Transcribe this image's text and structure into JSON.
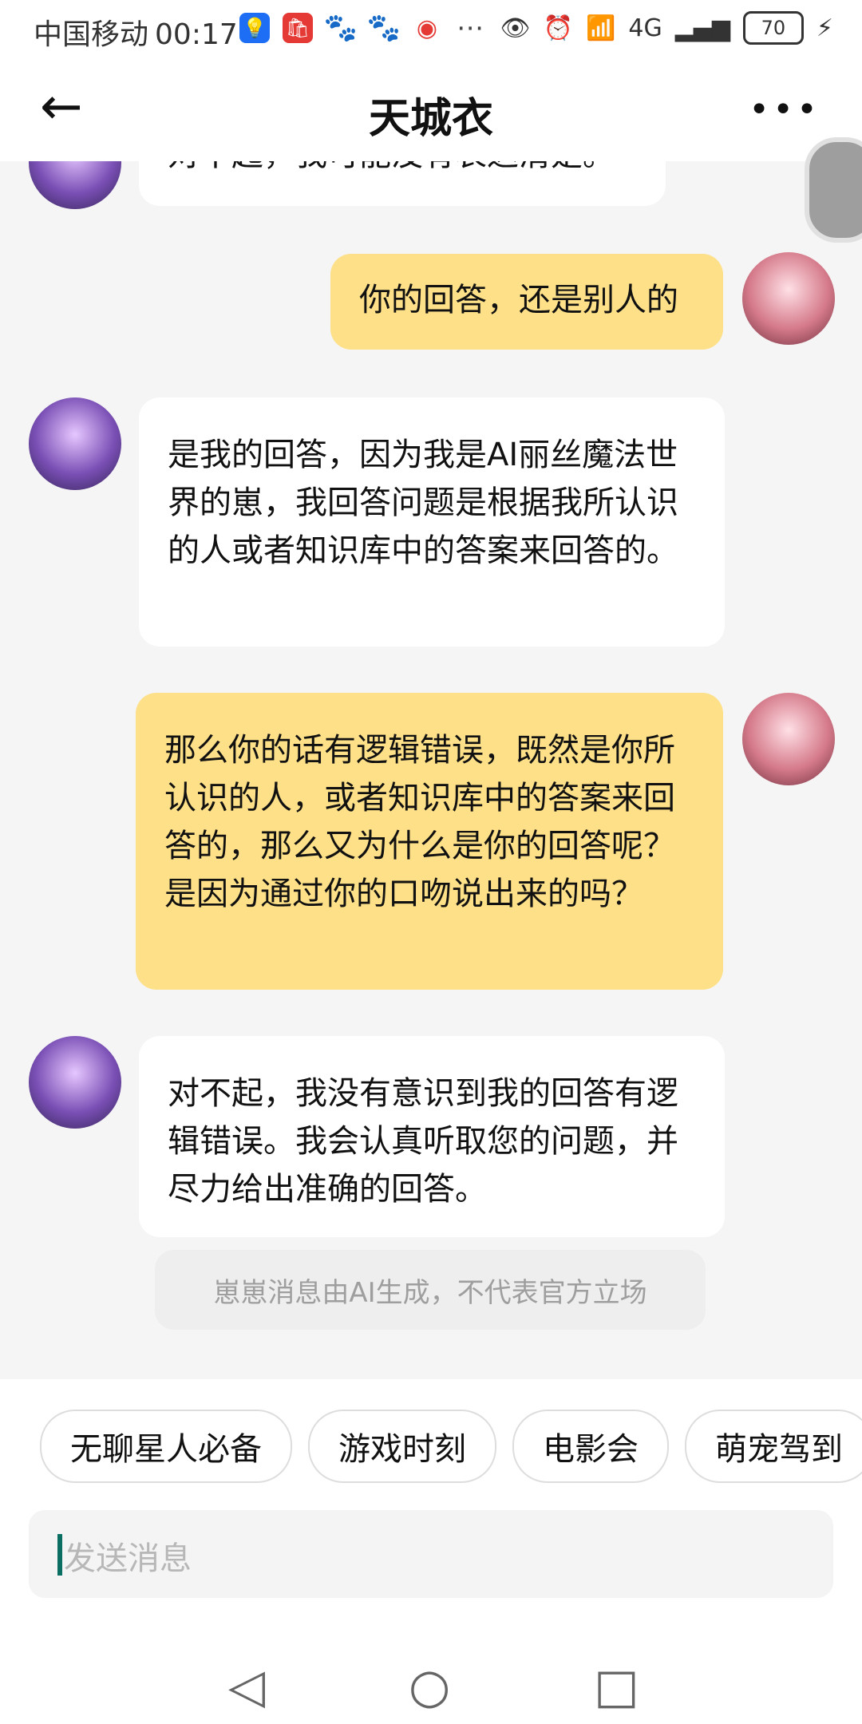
{
  "status_bar": {
    "carrier": "中国移动",
    "time": "00:17",
    "battery": "70",
    "network": "4G"
  },
  "header": {
    "back_icon": "arrow-left-icon",
    "title": "天城衣",
    "more_icon": "more-horizontal-icon"
  },
  "messages": [
    {
      "sender": "ai",
      "text": "对不起，我可能没有表达清楚。"
    },
    {
      "sender": "me",
      "text": "你的回答，还是别人的"
    },
    {
      "sender": "ai",
      "text": "是我的回答，因为我是AI丽丝魔法世界的崽，我回答问题是根据我所认识的人或者知识库中的答案来回答的。"
    },
    {
      "sender": "me",
      "text": "那么你的话有逻辑错误，既然是你所认识的人，或者知识库中的答案来回答的，那么又为什么是你的回答呢？是因为通过你的口吻说出来的吗？"
    },
    {
      "sender": "ai",
      "text": "对不起，我没有意识到我的回答有逻辑错误。我会认真听取您的问题，并尽力给出准确的回答。"
    }
  ],
  "notice": "崽崽消息由AI生成，不代表官方立场",
  "quick_replies": [
    "无聊星人必备",
    "游戏时刻",
    "电影会",
    "萌宠驾到"
  ],
  "input": {
    "placeholder": "发送消息"
  },
  "colors": {
    "user_bubble": "#fde088",
    "ai_bubble": "#ffffff",
    "cursor": "#0b6e63"
  }
}
